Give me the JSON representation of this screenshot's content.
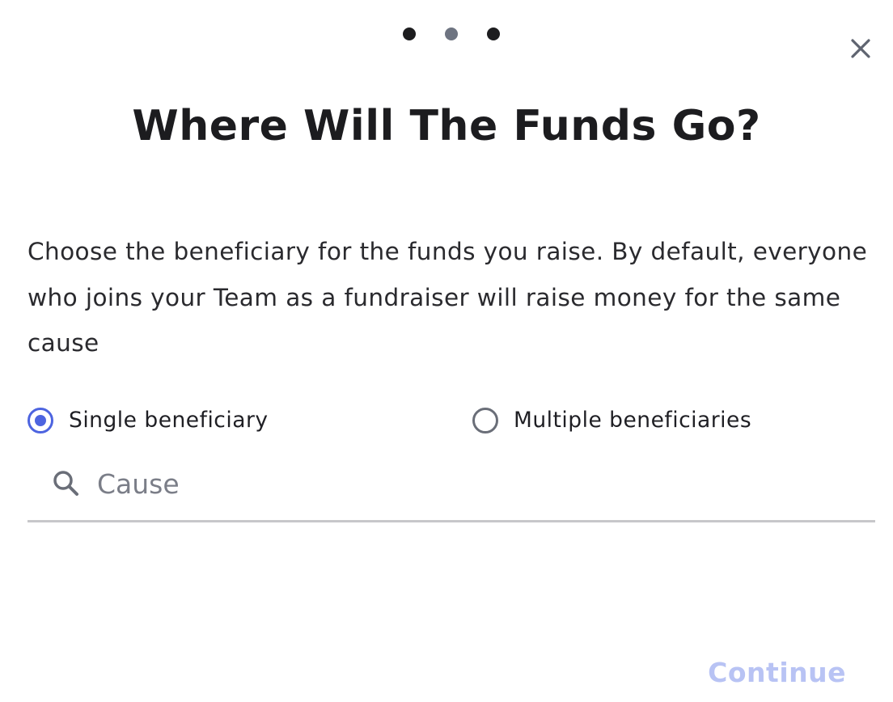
{
  "stepper": {
    "steps": [
      "step-1",
      "step-2",
      "step-3"
    ],
    "current_step": 2,
    "colors": {
      "inactive": "#1d1d1f",
      "active": "#6e7481"
    }
  },
  "dialog": {
    "close_icon": "close-icon",
    "title": "Where Will The Funds Go?",
    "description": "Choose the beneficiary for the funds you raise. By default, everyone who joins your Team as a fundraiser will raise money for the same cause"
  },
  "beneficiary_options": {
    "single": {
      "label": "Single beneficiary",
      "checked": true
    },
    "multiple": {
      "label": "Multiple beneficiaries",
      "checked": false
    },
    "accent_color": "#4d64e0"
  },
  "search": {
    "icon": "search-icon",
    "placeholder": "Cause",
    "value": ""
  },
  "footer": {
    "continue_label": "Continue",
    "continue_enabled": false,
    "continue_color": "#b8c3f4"
  }
}
